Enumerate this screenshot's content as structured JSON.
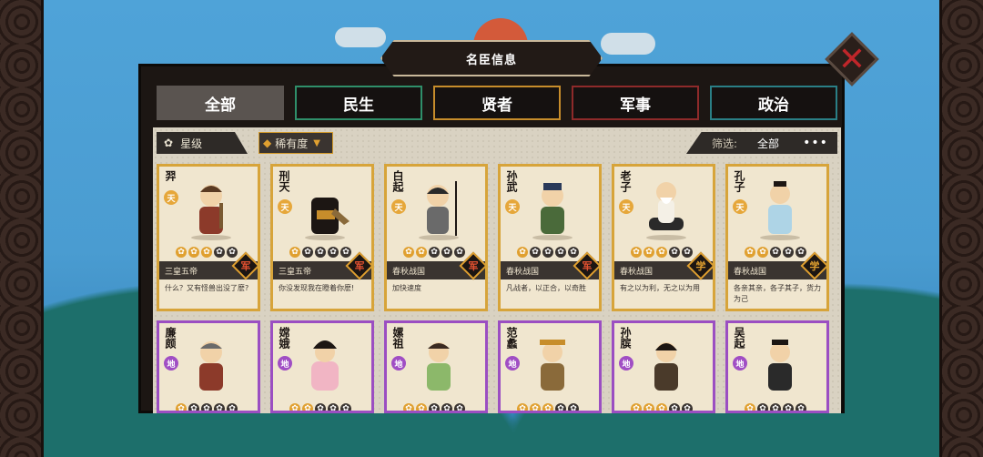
{
  "title": "名臣信息",
  "tabs": [
    {
      "label": "全部",
      "style": "active"
    },
    {
      "label": "民生",
      "style": "green"
    },
    {
      "label": "贤者",
      "style": "gold"
    },
    {
      "label": "军事",
      "style": "red"
    },
    {
      "label": "政治",
      "style": "teal"
    }
  ],
  "filter": {
    "star_label": "星级",
    "rarity_label": "稀有度",
    "filter_label": "筛选:",
    "filter_value": "全部"
  },
  "cards_row1": [
    {
      "name": "羿",
      "rank": "天",
      "era": "三皇五帝",
      "type": "军",
      "quote": "什么？又有怪兽出没了麽?",
      "stars": 3
    },
    {
      "name": "刑天",
      "rank": "天",
      "era": "三皇五帝",
      "type": "军",
      "quote": "你没发现我在瞪着你麽!",
      "stars": 1
    },
    {
      "name": "白起",
      "rank": "天",
      "era": "春秋战国",
      "type": "军",
      "quote": "加快速度",
      "stars": 2
    },
    {
      "name": "孙武",
      "rank": "天",
      "era": "春秋战国",
      "type": "军",
      "quote": "凡战者，以正合，以奇胜",
      "stars": 1
    },
    {
      "name": "老子",
      "rank": "天",
      "era": "春秋战国",
      "type": "学",
      "quote": "有之以为利，无之以为用",
      "stars": 3
    },
    {
      "name": "孔子",
      "rank": "天",
      "era": "春秋战国",
      "type": "学",
      "quote": "各亲其亲，各子其子，货力为己",
      "stars": 2
    }
  ],
  "cards_row2": [
    {
      "name": "廉颇",
      "rank": "地",
      "stars": 1
    },
    {
      "name": "嫦娥",
      "rank": "地",
      "stars": 2
    },
    {
      "name": "嫘祖",
      "rank": "地",
      "stars": 2
    },
    {
      "name": "范蠡",
      "rank": "地",
      "stars": 3
    },
    {
      "name": "孙膑",
      "rank": "地",
      "stars": 3
    },
    {
      "name": "吴起",
      "rank": "地",
      "stars": 1
    }
  ],
  "colors": {
    "gold_border": "#d7a43a",
    "purple_border": "#9b4ec2",
    "close_x": "#c0262a"
  },
  "icons": {
    "close": "close-icon",
    "star": "star-icon",
    "rarity": "diamond-icon",
    "more": "more-icon"
  }
}
